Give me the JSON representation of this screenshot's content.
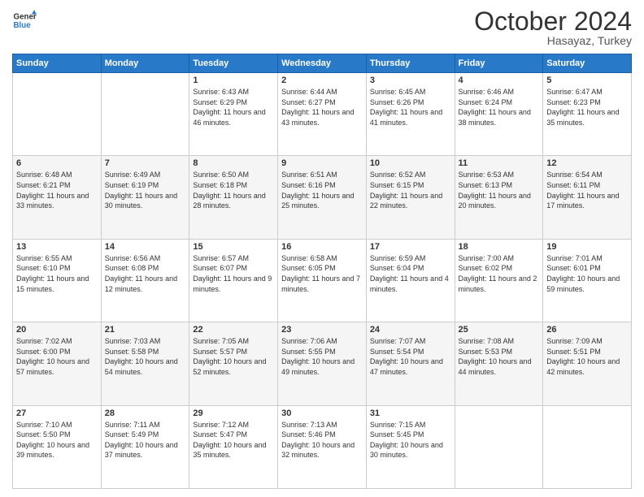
{
  "header": {
    "logo_line1": "General",
    "logo_line2": "Blue",
    "month": "October 2024",
    "location": "Hasayaz, Turkey"
  },
  "weekdays": [
    "Sunday",
    "Monday",
    "Tuesday",
    "Wednesday",
    "Thursday",
    "Friday",
    "Saturday"
  ],
  "weeks": [
    [
      {
        "day": "",
        "text": ""
      },
      {
        "day": "",
        "text": ""
      },
      {
        "day": "1",
        "text": "Sunrise: 6:43 AM\nSunset: 6:29 PM\nDaylight: 11 hours and 46 minutes."
      },
      {
        "day": "2",
        "text": "Sunrise: 6:44 AM\nSunset: 6:27 PM\nDaylight: 11 hours and 43 minutes."
      },
      {
        "day": "3",
        "text": "Sunrise: 6:45 AM\nSunset: 6:26 PM\nDaylight: 11 hours and 41 minutes."
      },
      {
        "day": "4",
        "text": "Sunrise: 6:46 AM\nSunset: 6:24 PM\nDaylight: 11 hours and 38 minutes."
      },
      {
        "day": "5",
        "text": "Sunrise: 6:47 AM\nSunset: 6:23 PM\nDaylight: 11 hours and 35 minutes."
      }
    ],
    [
      {
        "day": "6",
        "text": "Sunrise: 6:48 AM\nSunset: 6:21 PM\nDaylight: 11 hours and 33 minutes."
      },
      {
        "day": "7",
        "text": "Sunrise: 6:49 AM\nSunset: 6:19 PM\nDaylight: 11 hours and 30 minutes."
      },
      {
        "day": "8",
        "text": "Sunrise: 6:50 AM\nSunset: 6:18 PM\nDaylight: 11 hours and 28 minutes."
      },
      {
        "day": "9",
        "text": "Sunrise: 6:51 AM\nSunset: 6:16 PM\nDaylight: 11 hours and 25 minutes."
      },
      {
        "day": "10",
        "text": "Sunrise: 6:52 AM\nSunset: 6:15 PM\nDaylight: 11 hours and 22 minutes."
      },
      {
        "day": "11",
        "text": "Sunrise: 6:53 AM\nSunset: 6:13 PM\nDaylight: 11 hours and 20 minutes."
      },
      {
        "day": "12",
        "text": "Sunrise: 6:54 AM\nSunset: 6:11 PM\nDaylight: 11 hours and 17 minutes."
      }
    ],
    [
      {
        "day": "13",
        "text": "Sunrise: 6:55 AM\nSunset: 6:10 PM\nDaylight: 11 hours and 15 minutes."
      },
      {
        "day": "14",
        "text": "Sunrise: 6:56 AM\nSunset: 6:08 PM\nDaylight: 11 hours and 12 minutes."
      },
      {
        "day": "15",
        "text": "Sunrise: 6:57 AM\nSunset: 6:07 PM\nDaylight: 11 hours and 9 minutes."
      },
      {
        "day": "16",
        "text": "Sunrise: 6:58 AM\nSunset: 6:05 PM\nDaylight: 11 hours and 7 minutes."
      },
      {
        "day": "17",
        "text": "Sunrise: 6:59 AM\nSunset: 6:04 PM\nDaylight: 11 hours and 4 minutes."
      },
      {
        "day": "18",
        "text": "Sunrise: 7:00 AM\nSunset: 6:02 PM\nDaylight: 11 hours and 2 minutes."
      },
      {
        "day": "19",
        "text": "Sunrise: 7:01 AM\nSunset: 6:01 PM\nDaylight: 10 hours and 59 minutes."
      }
    ],
    [
      {
        "day": "20",
        "text": "Sunrise: 7:02 AM\nSunset: 6:00 PM\nDaylight: 10 hours and 57 minutes."
      },
      {
        "day": "21",
        "text": "Sunrise: 7:03 AM\nSunset: 5:58 PM\nDaylight: 10 hours and 54 minutes."
      },
      {
        "day": "22",
        "text": "Sunrise: 7:05 AM\nSunset: 5:57 PM\nDaylight: 10 hours and 52 minutes."
      },
      {
        "day": "23",
        "text": "Sunrise: 7:06 AM\nSunset: 5:55 PM\nDaylight: 10 hours and 49 minutes."
      },
      {
        "day": "24",
        "text": "Sunrise: 7:07 AM\nSunset: 5:54 PM\nDaylight: 10 hours and 47 minutes."
      },
      {
        "day": "25",
        "text": "Sunrise: 7:08 AM\nSunset: 5:53 PM\nDaylight: 10 hours and 44 minutes."
      },
      {
        "day": "26",
        "text": "Sunrise: 7:09 AM\nSunset: 5:51 PM\nDaylight: 10 hours and 42 minutes."
      }
    ],
    [
      {
        "day": "27",
        "text": "Sunrise: 7:10 AM\nSunset: 5:50 PM\nDaylight: 10 hours and 39 minutes."
      },
      {
        "day": "28",
        "text": "Sunrise: 7:11 AM\nSunset: 5:49 PM\nDaylight: 10 hours and 37 minutes."
      },
      {
        "day": "29",
        "text": "Sunrise: 7:12 AM\nSunset: 5:47 PM\nDaylight: 10 hours and 35 minutes."
      },
      {
        "day": "30",
        "text": "Sunrise: 7:13 AM\nSunset: 5:46 PM\nDaylight: 10 hours and 32 minutes."
      },
      {
        "day": "31",
        "text": "Sunrise: 7:15 AM\nSunset: 5:45 PM\nDaylight: 10 hours and 30 minutes."
      },
      {
        "day": "",
        "text": ""
      },
      {
        "day": "",
        "text": ""
      }
    ]
  ]
}
